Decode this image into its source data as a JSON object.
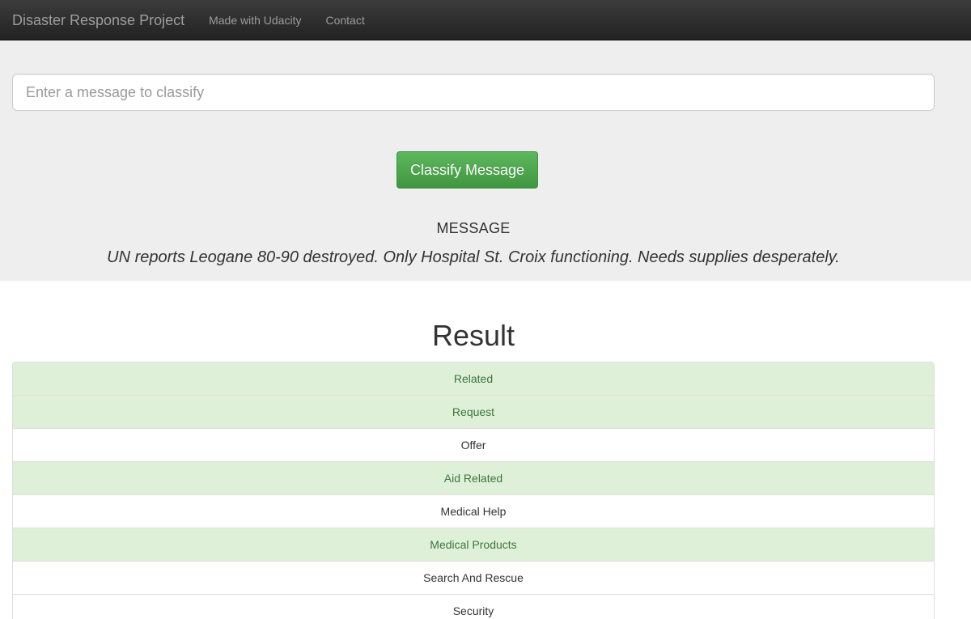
{
  "navbar": {
    "brand": "Disaster Response Project",
    "links": [
      "Made with Udacity",
      "Contact"
    ]
  },
  "form": {
    "placeholder": "Enter a message to classify",
    "button_label": "Classify Message"
  },
  "message": {
    "heading": "MESSAGE",
    "text": "UN reports Leogane 80-90 destroyed. Only Hospital St. Croix functioning. Needs supplies desperately."
  },
  "result": {
    "title": "Result",
    "categories": [
      {
        "label": "Related",
        "active": true
      },
      {
        "label": "Request",
        "active": true
      },
      {
        "label": "Offer",
        "active": false
      },
      {
        "label": "Aid Related",
        "active": true
      },
      {
        "label": "Medical Help",
        "active": false
      },
      {
        "label": "Medical Products",
        "active": true
      },
      {
        "label": "Search And Rescue",
        "active": false
      },
      {
        "label": "Security",
        "active": false
      }
    ]
  },
  "colors": {
    "navbar_bg": "#222222",
    "jumbotron_bg": "#eeeeee",
    "success_bg": "#dff0d8",
    "success_text": "#3c763d",
    "button_green": "#5cb85c"
  }
}
